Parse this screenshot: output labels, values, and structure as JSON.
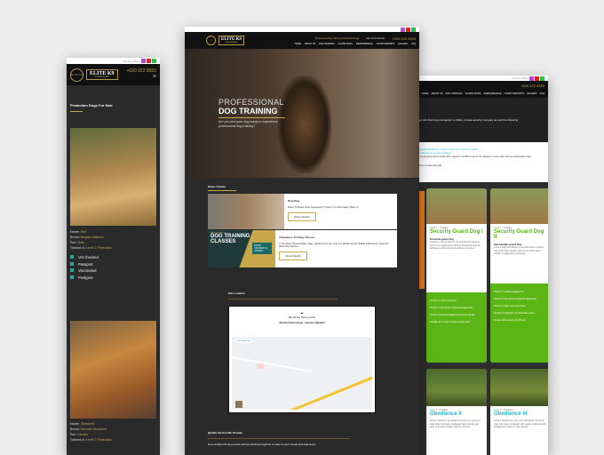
{
  "mobile": {
    "topbar": "Nirvana Pillars",
    "logo_circle": "ELITE K9",
    "logo": "ELITE K9",
    "logo_sub": "WORLDWIDE",
    "phone": "+020 222 9333",
    "menu_icon": "hamburger-icon",
    "section_title": "Protection Dogs For Sale",
    "dog1": {
      "name_label": "Name:",
      "name": "Rex",
      "breed_label": "Breed:",
      "breed": "Belgian Malinois",
      "sex_label": "Sex:",
      "sex": "Male",
      "trained_label": "Trained in:",
      "trained": "Level 2 Protection"
    },
    "checks": [
      "Vet checked",
      "Passport",
      "Vaccinated",
      "Pedigree"
    ],
    "dog2": {
      "name_label": "Name:",
      "name": "Shemshir",
      "breed_label": "Breed:",
      "breed": "German Shepherd",
      "sex_label": "Sex:",
      "sex": "Female",
      "trained_label": "Trained in:",
      "trained": "Level 3 Protection"
    }
  },
  "desktop": {
    "logo": "ELITE K9",
    "logo_sub": "WORLDWIDE",
    "tagline": "Professional Dog Training & Protection Dogs",
    "address": "Elite K9 Worldwide",
    "phone": "+020 222 9333",
    "nav": [
      "HOME",
      "ABOUT US",
      "DOG TRAINING",
      "GUARD DOGS",
      "PERFORMANCE",
      "COURT REPORTS",
      "GALLERY",
      "FAQ"
    ],
    "hero": {
      "line1": "PROFESSIONAL",
      "line2": "DOG TRAINING",
      "text": "Are you and your dog ready to experience professional dog training?"
    },
    "news_title": "News / Events",
    "news": [
      {
        "title": "Boarding",
        "text": "Board To Board Dogs Guaranteed To Keep Your Dog Happy While Yo",
        "button": "Show Details"
      },
      {
        "title": "Obedience Training Classes",
        "text": "In Our Basic Responsibility Class, Handle And Train Over The Weekend Into Toddler & Behaviour Class For Basic Best Service.",
        "button": "Show Details",
        "poster_small": "Reinforce the Stars",
        "poster_title": "DOG TRAINING CLASSES",
        "poster_badge": "EVERY SATURDAY & SUNDAY"
      }
    ],
    "location_title": "Our Location",
    "map_name": "Elite K9 Dog Training Centre",
    "map_address": "Woodend Farm Grange - Leicester, Nightland",
    "map_link": "View larger map",
    "services_title": "Quality Service We Provide",
    "services_text": "Here at Elite K9 we provide various training programs to cater to your needs and objectives."
  },
  "tablet": {
    "topbar": "Nirvana Pillars",
    "phone": "+020 222 9333",
    "nav": [
      "HOME",
      "ABOUT US",
      "DOG TRAINING",
      "GUARD DOGS",
      "PERFORMANCE",
      "COURT REPORTS",
      "GALLERY",
      "FAQ"
    ],
    "hero_text": "ous with their dog companion to Wilde, private security company as well the following",
    "intro": [
      "Dog guard family/home, network of kennels to educate it Insight",
      "pet behaviour in the field of training",
      "Accompanying Cart for trucks with a capped 2 m2 Will it need for the situation in course after Last we reading allies class",
      "Nature to make state gifts"
    ],
    "cards": [
      {
        "level": "Level 1",
        "duration": "4 weeks",
        "title": "Security Guard Dog I",
        "sub": "Essential guard dog",
        "text": "Teaches a dog to bark on command and protect its owner from aggressors. Moving forward all dogs by behaviour and ensuring obedience continues.",
        "bullets": [
          "Protect on voice command",
          "Protect on the threat of physical aggression",
          "Protect on threats adapted around the handler",
          "Suitable for on and off lead security work"
        ]
      },
      {
        "level": "Level 2",
        "duration": "6 weeks",
        "title": "Security Guard Dog II",
        "sub": "Intermediate guard dog",
        "text": "Level 2 dogs are trained to use their bite to defend and protect the handler with control of the dog in relation to aggressive behaviour.",
        "bullets": [
          "Protect on verbal engagement",
          "Protect on the threat of physical aggression",
          "Protect on high voice command",
          "Protect on approach and defensive action",
          "Protect without lead, full off lead"
        ]
      },
      {
        "level": "Level 2",
        "duration": "8 weeks",
        "title": "Obedience II",
        "text": "Level 2 training is an advanced course for young or adult dogs that have completed basic training and want to progress further with the handler."
      },
      {
        "level": "Level 3",
        "duration": "10 weeks",
        "title": "Obedience III",
        "text": "Level 3 Obedience is the most advanced course for dogs who have completed both earlier training levels, bringing full control on and off lead."
      }
    ]
  },
  "colors": {
    "gold": "#c9a94f",
    "green": "#5bb514",
    "teal": "#1bb9c9",
    "dark": "#2a2a2a"
  }
}
